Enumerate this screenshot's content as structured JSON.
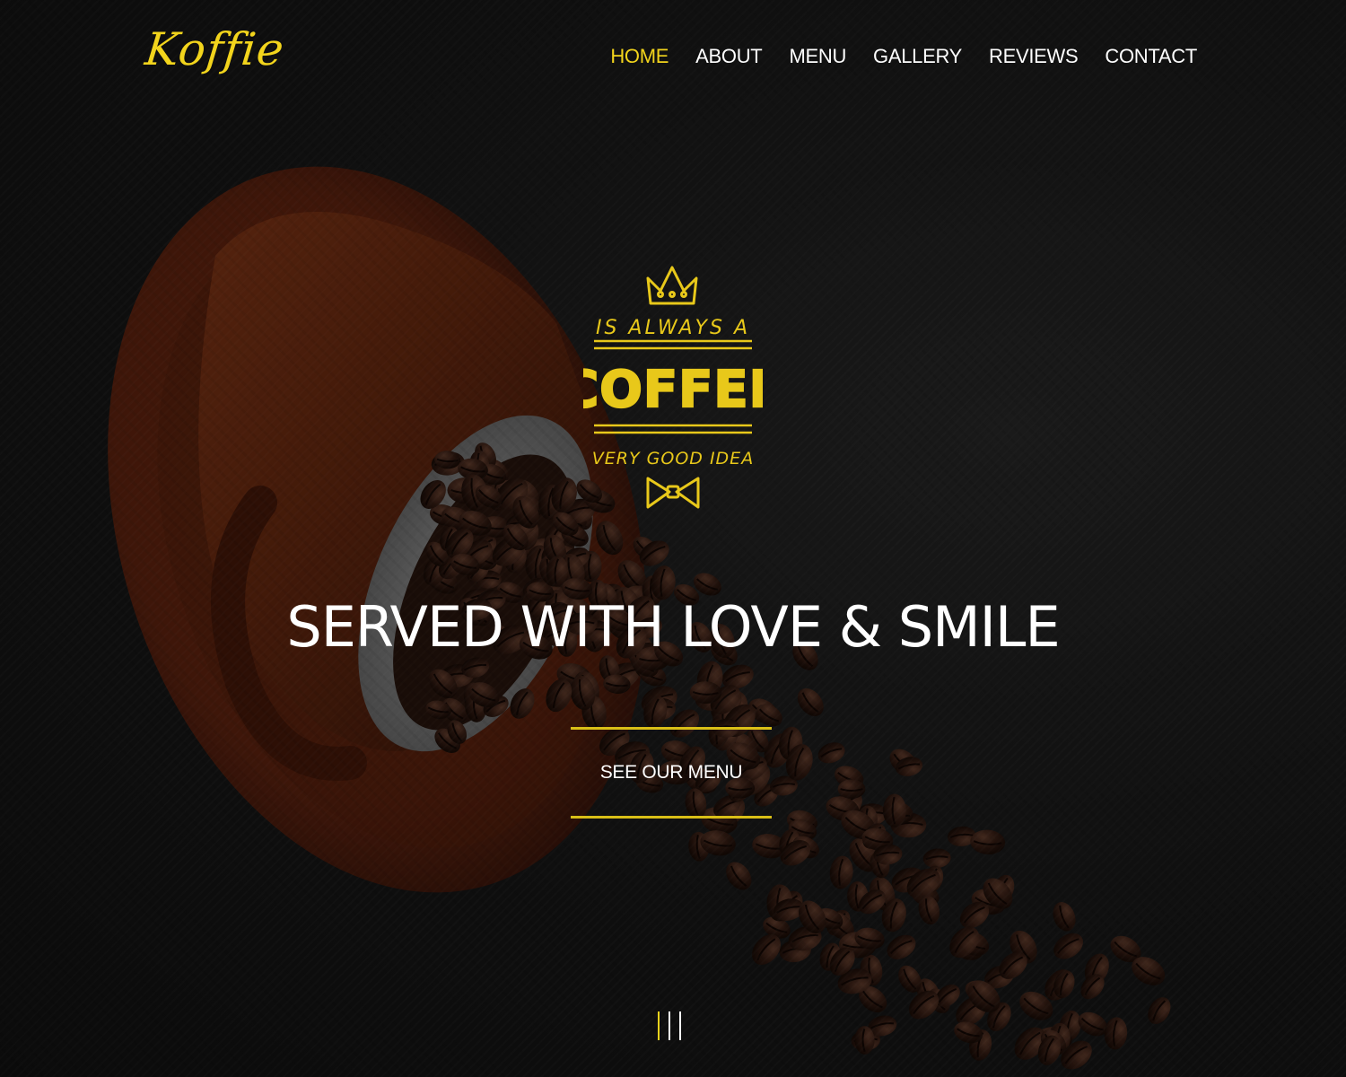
{
  "brand": {
    "logo_text": "Koffie",
    "accent_color": "#f2d41c"
  },
  "nav": {
    "items": [
      {
        "label": "HOME",
        "active": true
      },
      {
        "label": "ABOUT",
        "active": false
      },
      {
        "label": "MENU",
        "active": false
      },
      {
        "label": "GALLERY",
        "active": false
      },
      {
        "label": "REVIEWS",
        "active": false
      },
      {
        "label": "CONTACT",
        "active": false
      }
    ]
  },
  "badge": {
    "top_line": "IS ALWAYS A",
    "main_word": "COFFEE",
    "bottom_line": "VERY GOOD IDEA",
    "top_icon": "crown-icon",
    "bottom_icon": "bowtie-icon"
  },
  "hero": {
    "headline": "SERVED WITH LOVE & SMILE",
    "cta_label": "SEE OUR MENU"
  },
  "scroll": {
    "icon": "scroll-indicator-icon"
  }
}
